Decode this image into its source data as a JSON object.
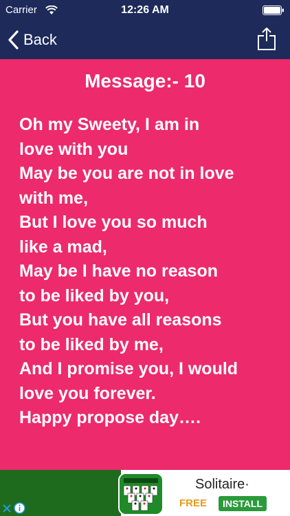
{
  "status_bar": {
    "carrier": "Carrier",
    "time": "12:26 AM"
  },
  "navbar": {
    "back_label": "Back",
    "share_icon": "share-icon"
  },
  "message": {
    "title": "Message:- 10",
    "lines": [
      "Oh my Sweety, I am in",
      "love with you",
      "May be you are not in love",
      "with me,",
      "But I love you so much",
      "like a mad,",
      "May be I have no reason",
      "to be liked by you,",
      "But you have all reasons",
      "to be liked by me,",
      "And I promise you, I would",
      "love you forever.",
      "Happy propose day…."
    ]
  },
  "ad": {
    "title": "Solitaire·",
    "free_label": "FREE",
    "install_label": "INSTALL"
  },
  "colors": {
    "background": "#ec2a6c",
    "navbar": "#1d2a5a",
    "text": "#ffffff"
  }
}
